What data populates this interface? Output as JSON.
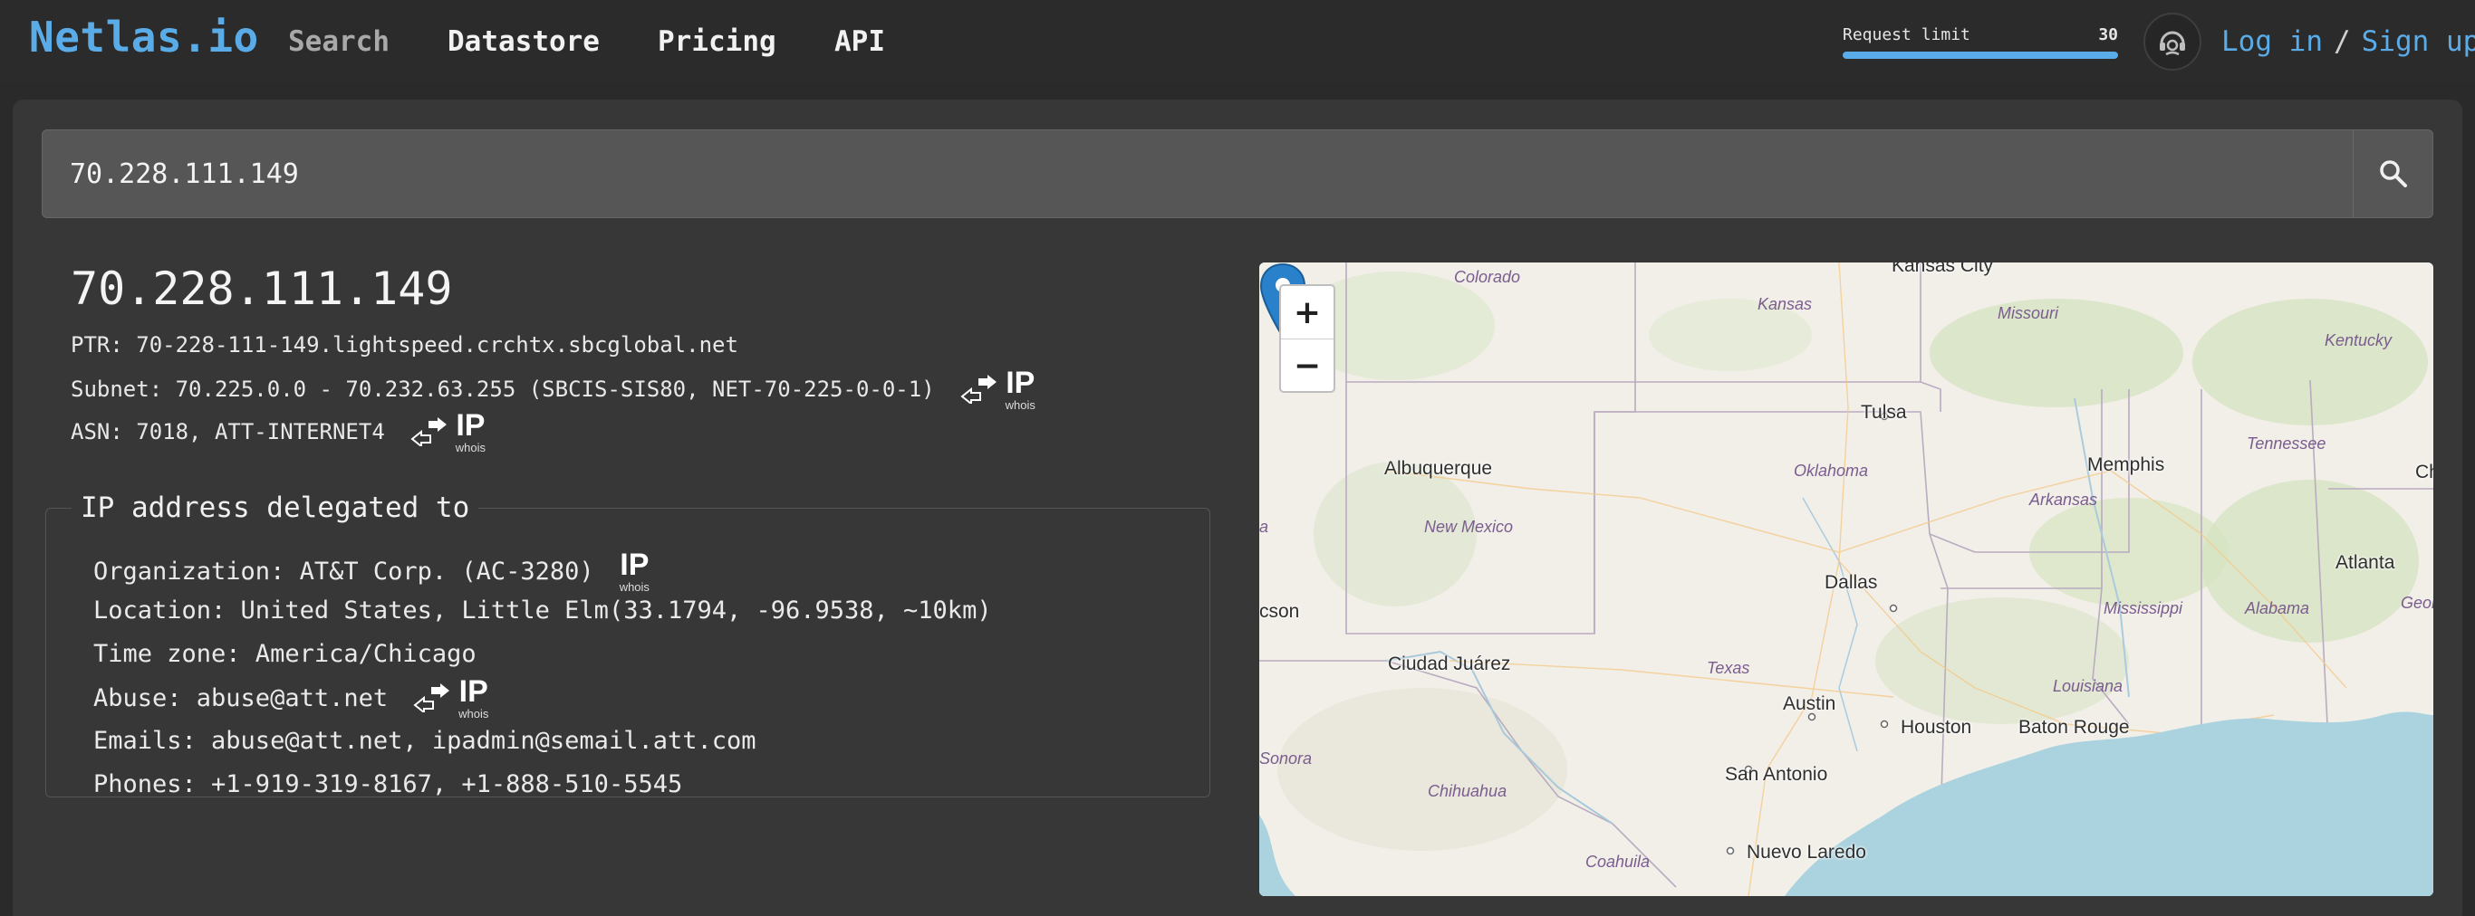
{
  "nav": {
    "brand": "Netlas.io",
    "links": [
      "Search",
      "Datastore",
      "Pricing",
      "API"
    ],
    "request_limit": {
      "label": "Request limit",
      "count": "30",
      "fill_fraction": 1.0
    },
    "login": "Log in",
    "separator": "/",
    "signup": "Sign up"
  },
  "search": {
    "value": "70.228.111.149",
    "icon": "search-icon"
  },
  "ip": {
    "title": "70.228.111.149",
    "ptr": "PTR: 70-228-111-149.lightspeed.crchtx.sbcglobal.net",
    "subnet": "Subnet: 70.225.0.0 - 70.232.63.255 (SBCIS-SIS80, NET-70-225-0-0-1)",
    "asn": "ASN: 7018, ATT-INTERNET4"
  },
  "whois_badge": {
    "main": "IP",
    "sub": "whois"
  },
  "delegation": {
    "legend": "IP address delegated to",
    "organization": "Organization: AT&T Corp. (AC-3280)",
    "location": "Location: United States, Little Elm(33.1794, -96.9538, ~10km)",
    "timezone": "Time zone: America/Chicago",
    "abuse": "Abuse: abuse@att.net",
    "emails": "Emails: abuse@att.net, ipadmin@semail.att.com",
    "phones": "Phones: +1-919-319-8167, +1-888-510-5545"
  },
  "map": {
    "zoom_in": "+",
    "zoom_out": "−",
    "cities": [
      "Kansas City",
      "Tulsa",
      "Memphis",
      "Albuquerque",
      "Dallas",
      "Atlanta",
      "Ciudad Juárez",
      "Austin",
      "Houston",
      "Baton Rouge",
      "San Antonio",
      "Nuevo Laredo",
      "cson",
      "Ch"
    ],
    "states": [
      "Colorado",
      "Kansas",
      "Missouri",
      "Kentucky",
      "Oklahoma",
      "Tennessee",
      "New Mexico",
      "Arkansas",
      "Mississippi",
      "Alabama",
      "Georgi",
      "Texas",
      "Louisiana",
      "Sonora",
      "Chihuahua",
      "Coahuila",
      "a"
    ]
  },
  "colors": {
    "brand": "#5aace9",
    "link": "#5aace9",
    "request_bar": "#5aace9",
    "water": "#aad3df",
    "marker": "#2a81cb"
  }
}
